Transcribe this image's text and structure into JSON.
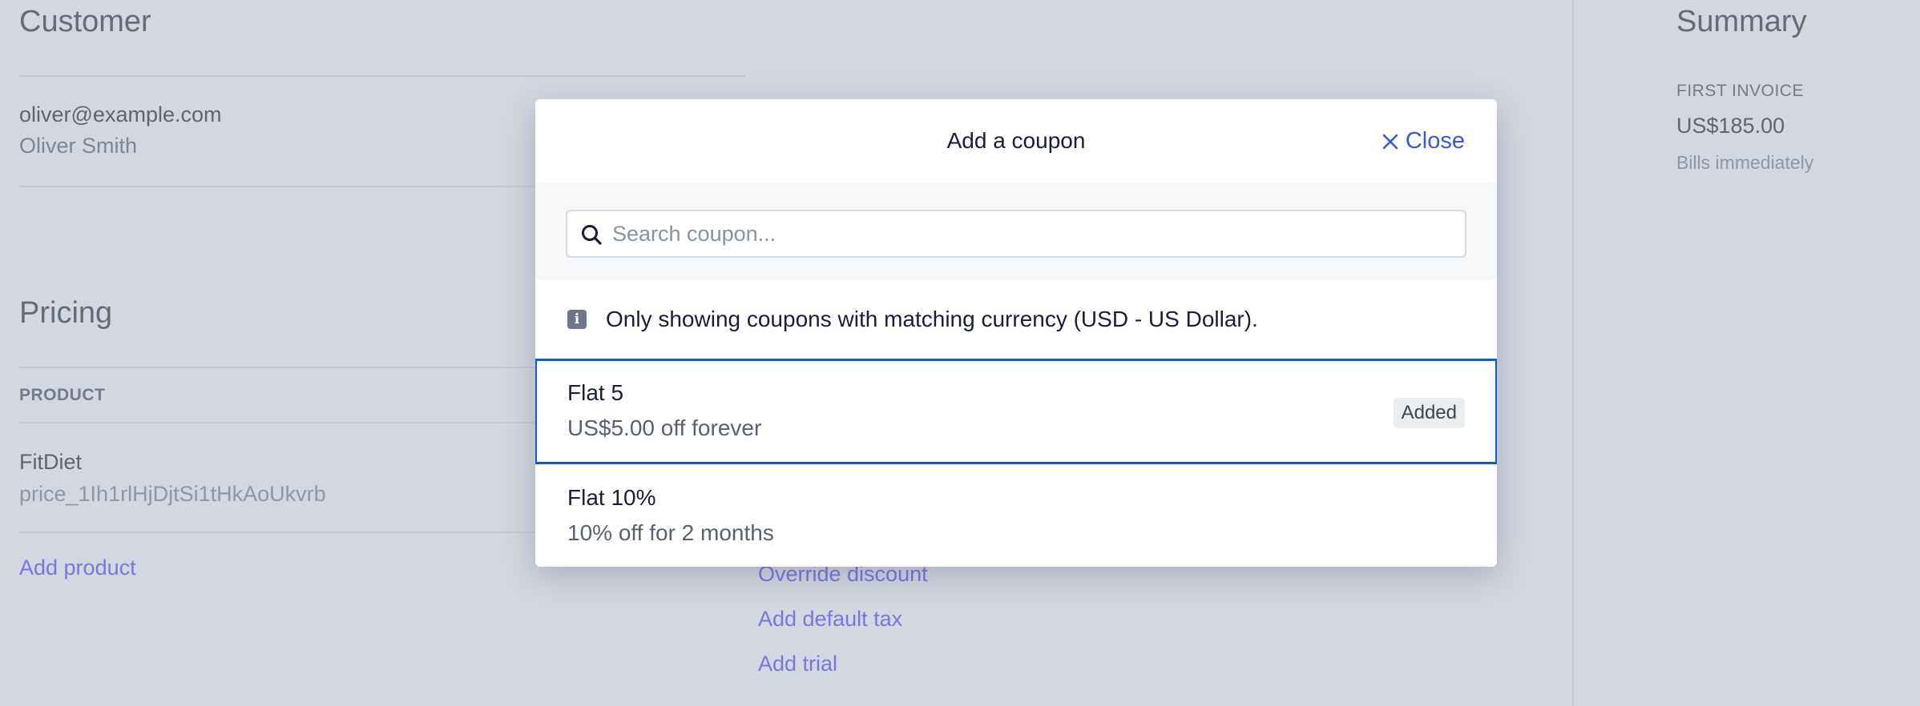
{
  "customer": {
    "title": "Customer",
    "email": "oliver@example.com",
    "name": "Oliver Smith"
  },
  "pricing": {
    "title": "Pricing",
    "product_header": "PRODUCT",
    "product_name": "FitDiet",
    "price_id": "price_1Ih1rlHjDjtSi1tHkAoUkvrb",
    "add_product": "Add product"
  },
  "options": {
    "links": [
      "Override discount",
      "Add default tax",
      "Add trial"
    ]
  },
  "summary": {
    "title": "Summary",
    "first_invoice": "FIRST INVOICE",
    "amount": "US$185.00",
    "bills": "Bills immediately"
  },
  "modal": {
    "title": "Add a coupon",
    "close_label": "Close",
    "search_placeholder": "Search coupon...",
    "search_value": "",
    "info": "Only showing coupons with matching currency (USD - US Dollar).",
    "coupons": [
      {
        "name": "Flat 5",
        "description": "US$5.00 off forever",
        "badge": "Added",
        "selected": true
      },
      {
        "name": "Flat 10%",
        "description": "10% off for 2 months",
        "badge": "",
        "selected": false
      }
    ]
  },
  "colors": {
    "accent": "#3a57d6",
    "selected_border": "#0b5ec9",
    "link": "#635bff",
    "overlay": "rgba(150,160,180,0.42)"
  },
  "icons": [
    "search-icon",
    "close-icon",
    "info-icon"
  ]
}
